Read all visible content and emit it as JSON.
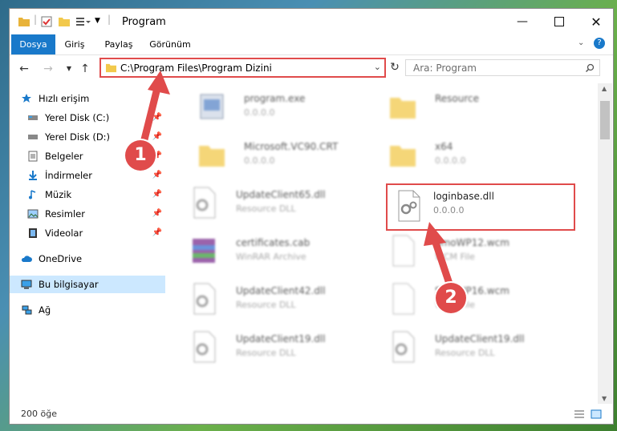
{
  "window": {
    "title": "Program"
  },
  "ribbon": {
    "tabs": [
      "Dosya",
      "Giriş",
      "Paylaş",
      "Görünüm"
    ]
  },
  "address": {
    "path": "C:\\Program Files\\Program Dizini"
  },
  "search": {
    "placeholder": "Ara: Program"
  },
  "nav": {
    "quick_access": "Hızlı erişim",
    "items": [
      "Yerel Disk (C:)",
      "Yerel Disk (D:)",
      "Belgeler",
      "İndirmeler",
      "Müzik",
      "Resimler",
      "Videolar"
    ],
    "onedrive": "OneDrive",
    "this_pc": "Bu bilgisayar",
    "network": "Ağ"
  },
  "files": [
    {
      "name": "program.exe",
      "sub": "0.0.0.0"
    },
    {
      "name": "Resource",
      "sub": ""
    },
    {
      "name": "Microsoft.VC90.CRT",
      "sub": "0.0.0.0"
    },
    {
      "name": "x64",
      "sub": "0.0.0.0"
    },
    {
      "name": "UpdateClient65.dll",
      "sub": "Resource DLL"
    },
    {
      "name": "loginbase.dll",
      "sub": "0.0.0.0"
    },
    {
      "name": "certificates.cab",
      "sub": "WinRAR Archive"
    },
    {
      "name": "SmoWP12.wcm",
      "sub": "WCM File"
    },
    {
      "name": "UpdateClient42.dll",
      "sub": "Resource DLL"
    },
    {
      "name": "SmoWP16.wcm",
      "sub": "WCM File"
    },
    {
      "name": "UpdateClient19.dll",
      "sub": "Resource DLL"
    },
    {
      "name": "UpdateClient19.dll",
      "sub": "Resource DLL"
    }
  ],
  "status": {
    "count": "200 öğe"
  },
  "annotations": {
    "step1": "1",
    "step2": "2"
  },
  "colors": {
    "accent": "#1979ca",
    "annotation": "#e04b4b",
    "selection": "#cce8ff"
  }
}
